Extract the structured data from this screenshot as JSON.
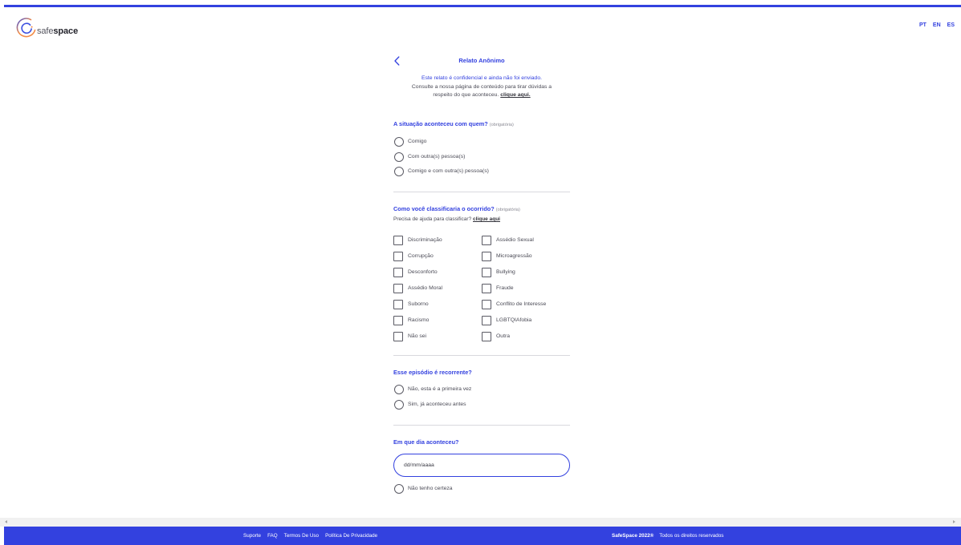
{
  "colors": {
    "primary": "#3341df",
    "text": "#4a4a55",
    "muted": "#8b8b95",
    "divider": "#d9d9de",
    "control": "#5a5a64",
    "footer_text": "#ffffff",
    "scrollbar": "#f1f1f1",
    "logo_orange": "#f28b46",
    "logo_blue": "#3b4fe0"
  },
  "icons": {
    "logo": "safespace-logo-icon",
    "back": "chevron-left-icon",
    "scroll_left": "scroll-left-arrow-icon",
    "scroll_right": "scroll-right-arrow-icon"
  },
  "brand": {
    "name_light": "safe",
    "name_bold": "space"
  },
  "languages": [
    "PT",
    "EN",
    "ES"
  ],
  "header": {
    "title": "Relato Anônimo"
  },
  "intro": {
    "line1": "Este relato é confidencial e ainda não foi enviado.",
    "line2": "Consulte a nossa página de conteúdo para tirar dúvidas a",
    "line3": "respeito do que aconteceu.",
    "link": "clique aqui."
  },
  "q1": {
    "title": "A situação aconteceu com quem?",
    "required": "(obrigatória)",
    "options": [
      "Comigo",
      "Com outra(s) pessoa(s)",
      "Comigo e com outra(s) pessoa(s)"
    ]
  },
  "q2": {
    "title": "Como você classificaria o ocorrido?",
    "required": "(obrigatória)",
    "help_text": "Precisa de ajuda para classificar?",
    "help_link": "clique aqui",
    "options_left": [
      "Discriminação",
      "Corrupção",
      "Desconforto",
      "Assédio Moral",
      "Suborno",
      "Racismo",
      "Não sei"
    ],
    "options_right": [
      "Assédio Sexual",
      "Microagressão",
      "Bullying",
      "Fraude",
      "Conflito de Interesse",
      "LGBTQIAfobia",
      "Outra"
    ]
  },
  "q3": {
    "title": "Esse episódio é recorrente?",
    "options": [
      "Não, esta é a primeira vez",
      "Sim, já aconteceu antes"
    ]
  },
  "q4": {
    "title": "Em que dia aconteceu?",
    "date_placeholder": "dd/mm/aaaa",
    "unsure_option": "Não tenho certeza"
  },
  "footer": {
    "links": [
      "Suporte",
      "FAQ",
      "Termos De Uso",
      "Política De Privacidade"
    ],
    "copyright": "SafeSpace 2022®",
    "rights": "Todos os direitos reservados"
  }
}
